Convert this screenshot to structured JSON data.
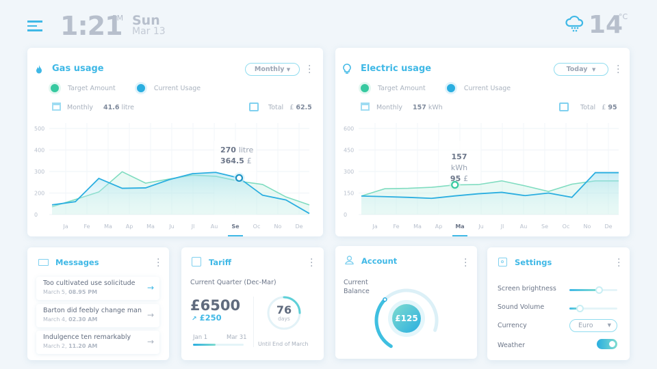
{
  "header": {
    "time": "1:21",
    "ampm": "PM",
    "day": "Sun",
    "date": "Mar 13",
    "weather_icon": "cloud-rain-icon",
    "temperature": "14",
    "temp_unit": "°C",
    "menu_icon": "hamburger-menu-icon"
  },
  "colors": {
    "accent": "#3fb8e6",
    "target": "#36c9a0",
    "current": "#2aaee0",
    "background": "#f1f6fa",
    "text": "#5f6b80"
  },
  "gas": {
    "title": "Gas usage",
    "icon": "flame-icon",
    "period": "Monthly",
    "legend": [
      "Target Amount",
      "Current Usage"
    ],
    "monthly_label": "Monthly",
    "monthly_value": "41.6",
    "monthly_unit": "litre",
    "total_label": "Total",
    "total_currency": "£",
    "total_value": "62.5",
    "tooltip_line1_value": "270",
    "tooltip_line1_unit": "litre",
    "tooltip_line2_value": "364.5",
    "tooltip_line2_unit": "£"
  },
  "electric": {
    "title": "Electric usage",
    "icon": "lightbulb-icon",
    "period": "Today",
    "legend": [
      "Target Amount",
      "Current Usage"
    ],
    "monthly_label": "Monthly",
    "monthly_value": "157",
    "monthly_unit": "kWh",
    "total_label": "Total",
    "total_currency": "£",
    "total_value": "95",
    "tooltip_line1_value": "157",
    "tooltip_line1_unit": "kWh",
    "tooltip_line2_value": "95",
    "tooltip_line2_unit": "£"
  },
  "chart_data": [
    {
      "type": "line",
      "ytick_labels": [
        "500",
        "400",
        "300",
        "200",
        "0"
      ],
      "ylim": [
        100,
        500
      ],
      "categories": [
        "Ja",
        "Fe",
        "Ma",
        "Ap",
        "Ma",
        "Ju",
        "Jl",
        "Au",
        "Se",
        "Oc",
        "No",
        "De"
      ],
      "selected": "Se",
      "grid": true,
      "series": [
        {
          "name": "Target Amount",
          "values": [
            136,
            170,
            205,
            299,
            246,
            265,
            283,
            278,
            255,
            240,
            182,
            145
          ]
        },
        {
          "name": "Current Usage",
          "values": [
            145,
            160,
            268,
            222,
            224,
            262,
            290,
            296,
            270,
            190,
            168,
            105
          ]
        }
      ]
    },
    {
      "type": "line",
      "ytick_labels": [
        "600",
        "450",
        "300",
        "150",
        "0"
      ],
      "ylim": [
        0,
        600
      ],
      "categories": [
        "Ja",
        "Fe",
        "Ma",
        "Ap",
        "Ma",
        "Ju",
        "Jl",
        "Au",
        "Se",
        "Oc",
        "No",
        "De"
      ],
      "selected": "Ma",
      "selected_index": 4,
      "grid": true,
      "series": [
        {
          "name": "Target Amount",
          "values": [
            129,
            180,
            183,
            190,
            207,
            209,
            235,
            200,
            161,
            212,
            235,
            235
          ]
        },
        {
          "name": "Current Usage",
          "values": [
            129,
            125,
            120,
            113,
            130,
            145,
            155,
            132,
            150,
            120,
            292,
            292
          ]
        }
      ]
    }
  ],
  "messages": {
    "title": "Messages",
    "items": [
      {
        "text": "Too cultivated use solicitude",
        "date": "March 5,",
        "time": "08.95 PM"
      },
      {
        "text": "Barton did feebly change man",
        "date": "March 4,",
        "time": "02.30 AM"
      },
      {
        "text": "Indulgence ten remarkably",
        "date": "March 2,",
        "time": "11.20 AM"
      }
    ]
  },
  "tariff": {
    "title": "Tariff",
    "quarter": "Current Quarter (Dec-Mar)",
    "amount": "£6500",
    "change": "£250",
    "start": "Jan 1",
    "end": "Mar 31",
    "progress": 0.45,
    "days": "76",
    "days_label": "days",
    "until": "Until End of March",
    "days_progress": 0.25
  },
  "account": {
    "title": "Account",
    "balance_label_1": "Current",
    "balance_label_2": "Balance",
    "balance": "£125",
    "balance_progress": 0.4
  },
  "settings": {
    "title": "Settings",
    "brightness_label": "Screen brightness",
    "brightness": 0.62,
    "volume_label": "Sound Volume",
    "volume": 0.22,
    "currency_label": "Currency",
    "currency": "Euro",
    "weather_label": "Weather",
    "weather_on": true
  }
}
